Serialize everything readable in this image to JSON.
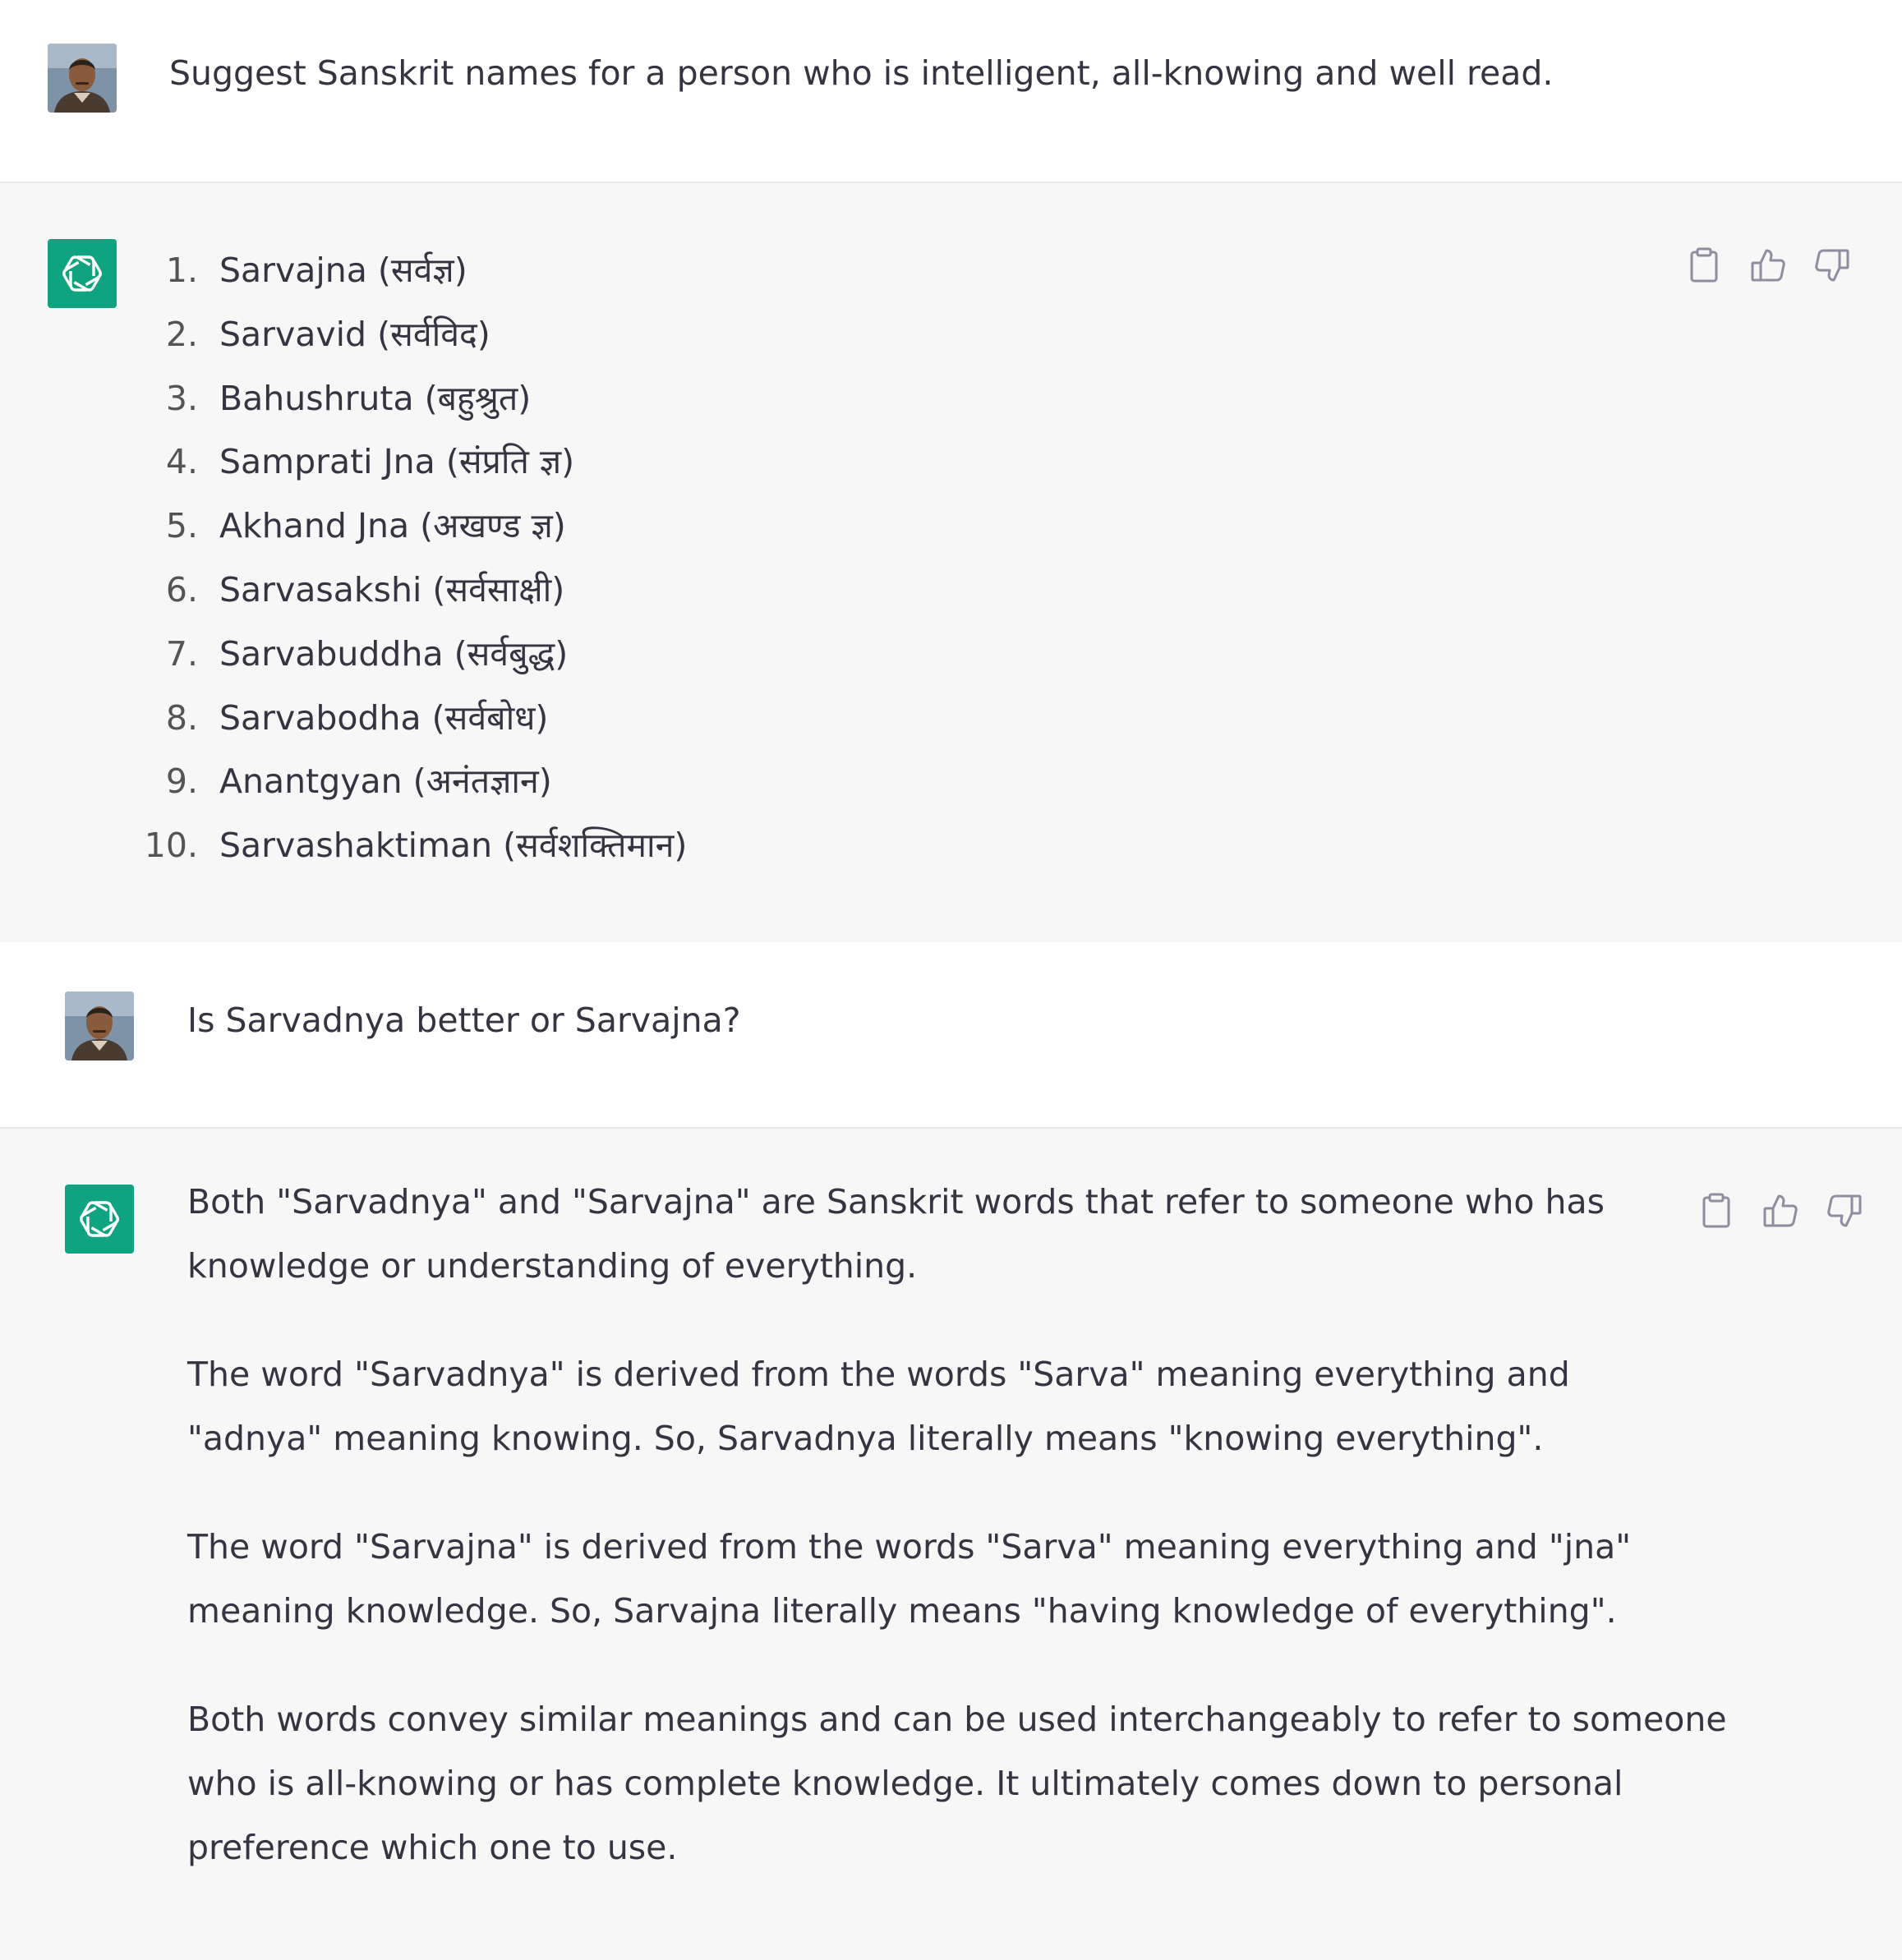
{
  "conversation": {
    "messages": [
      {
        "role": "user",
        "text": "Suggest Sanskrit names for a person who is intelligent, all-knowing and well read."
      },
      {
        "role": "assistant",
        "list": [
          {
            "num": "1.",
            "text": "Sarvajna (सर्वज्ञ)"
          },
          {
            "num": "2.",
            "text": "Sarvavid (सर्वविद)"
          },
          {
            "num": "3.",
            "text": "Bahushruta (बहुश्रुत)"
          },
          {
            "num": "4.",
            "text": "Samprati Jna (संप्रति ज्ञ)"
          },
          {
            "num": "5.",
            "text": "Akhand Jna (अखण्ड ज्ञ)"
          },
          {
            "num": "6.",
            "text": "Sarvasakshi (सर्वसाक्षी)"
          },
          {
            "num": "7.",
            "text": "Sarvabuddha (सर्वबुद्ध)"
          },
          {
            "num": "8.",
            "text": "Sarvabodha (सर्वबोध)"
          },
          {
            "num": "9.",
            "text": "Anantgyan (अनंतज्ञान)"
          },
          {
            "num": "10.",
            "text": "Sarvashaktiman (सर्वशक्तिमान)"
          }
        ]
      },
      {
        "role": "user",
        "text": "Is Sarvadnya better or Sarvajna?"
      },
      {
        "role": "assistant",
        "paragraphs": [
          "Both \"Sarvadnya\" and \"Sarvajna\" are Sanskrit words that refer to someone who has knowledge or understanding of everything.",
          "The word \"Sarvadnya\" is derived from the words \"Sarva\" meaning everything and \"adnya\" meaning knowing. So, Sarvadnya literally means \"knowing everything\".",
          "The word \"Sarvajna\" is derived from the words \"Sarva\" meaning everything and \"jna\" meaning knowledge. So, Sarvajna literally means \"having knowledge of everything\".",
          "Both words convey similar meanings and can be used interchangeably to refer to someone who is all-knowing or has complete knowledge. It ultimately comes down to personal preference which one to use."
        ]
      }
    ],
    "actions": {
      "copy_icon": "clipboard-icon",
      "like_icon": "thumbs-up-icon",
      "dislike_icon": "thumbs-down-icon"
    },
    "colors": {
      "assistant_avatar": "#10a37f",
      "assistant_bg": "#f7f7f8",
      "user_bg": "#ffffff",
      "text": "#343541"
    }
  }
}
